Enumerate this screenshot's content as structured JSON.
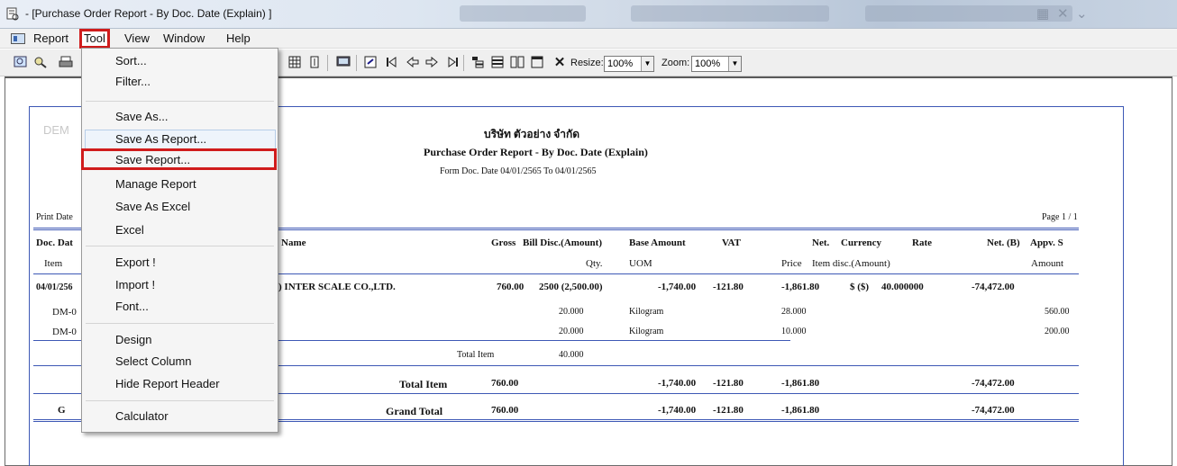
{
  "window": {
    "title": "- [Purchase Order Report - By Doc. Date (Explain) ]"
  },
  "menubar": {
    "items": [
      "Report",
      "Tool",
      "View",
      "Window",
      "Help"
    ]
  },
  "toolbar": {
    "resize_label": "Resize:",
    "resize_value": "100%",
    "zoom_label": "Zoom:",
    "zoom_value": "100%"
  },
  "tool_menu": {
    "items": [
      "Sort...",
      "Filter...",
      "Save As...",
      "Save As Report...",
      "Save Report...",
      "Manage Report",
      "Save As Excel",
      "Excel",
      "Export !",
      "Import !",
      "Font...",
      "Design",
      "Select Column",
      "Hide Report Header",
      "Calculator"
    ]
  },
  "report": {
    "watermark": "DEM",
    "company": "บริษัท ตัวอย่าง จำกัด",
    "title": "Purchase Order Report - By Doc. Date (Explain)",
    "date_range": "Form Doc. Date 04/01/2565 To 04/01/2565",
    "print_date_label": "Print Date",
    "page": "Page 1 / 1",
    "header1": {
      "doc_date": "Doc. Dat",
      "name": "Name",
      "gross": "Gross",
      "bill_disc": "Bill Disc.(Amount)",
      "base_amount": "Base Amount",
      "vat": "VAT",
      "net": "Net.",
      "currency": "Currency",
      "rate": "Rate",
      "net_b": "Net. (B)",
      "appv": "Appv. S"
    },
    "header2": {
      "item": "Item",
      "qty": "Qty.",
      "uom": "UOM",
      "price": "Price",
      "item_disc": "Item disc.(Amount)",
      "amount": "Amount"
    },
    "doc_row": {
      "date": "04/01/256",
      "supplier": ") INTER SCALE CO.,LTD.",
      "gross": "760.00",
      "bill_disc": "2500 (2,500.00)",
      "base": "-1,740.00",
      "vat": "-121.80",
      "net": "-1,861.80",
      "currency": "$ ($)",
      "rate": "40.000000",
      "net_b": "-74,472.00"
    },
    "items": [
      {
        "code": "DM-0",
        "qty": "20.000",
        "uom": "Kilogram",
        "price": "28.000",
        "amount": "560.00"
      },
      {
        "code": "DM-0",
        "qty": "20.000",
        "uom": "Kilogram",
        "price": "10.000",
        "amount": "200.00"
      }
    ],
    "total_item_row": {
      "label": "Total Item",
      "qty": "40.000"
    },
    "subtotal": {
      "label": "Total Item",
      "gross": "760.00",
      "base": "-1,740.00",
      "vat": "-121.80",
      "net": "-1,861.80",
      "net_b": "-74,472.00"
    },
    "grand": {
      "prefix": "G",
      "label": "Grand Total",
      "gross": "760.00",
      "base": "-1,740.00",
      "vat": "-121.80",
      "net": "-1,861.80",
      "net_b": "-74,472.00"
    }
  }
}
